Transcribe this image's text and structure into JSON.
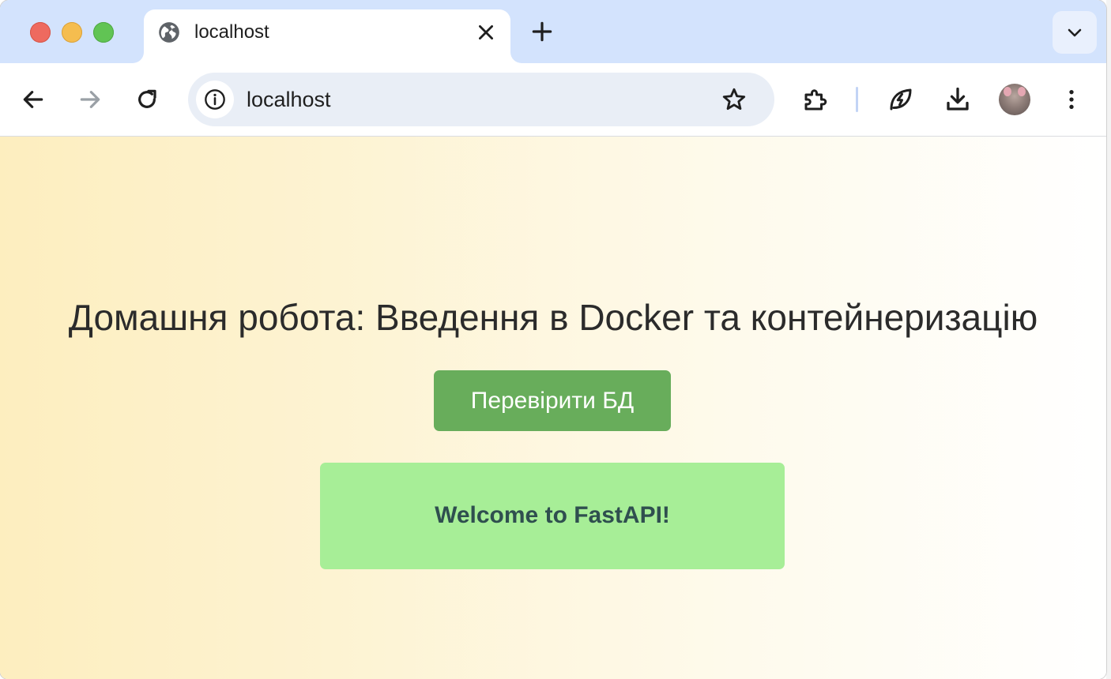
{
  "browser": {
    "tab": {
      "title": "localhost"
    },
    "omnibox": {
      "url": "localhost"
    }
  },
  "page": {
    "heading": "Домашня робота: Введення в Docker та контейнеризацію",
    "check_button_label": "Перевірити БД",
    "result_message": "Welcome to FastAPI!"
  },
  "icons": {
    "favicon": "globe-icon",
    "tab_close": "close-icon",
    "new_tab": "plus-icon",
    "tab_search": "chevron-down-icon",
    "back": "arrow-left-icon",
    "forward": "arrow-right-icon",
    "reload": "reload-icon",
    "site_info": "info-icon",
    "bookmark": "star-icon",
    "extensions": "puzzle-icon",
    "performance": "leaf-bolt-icon",
    "downloads": "download-icon",
    "menu": "kebab-menu-icon"
  },
  "colors": {
    "tabstrip": "#d3e3fd",
    "omnibox": "#e9eef6",
    "button": "#68ad5b",
    "result_box": "#a7ee97",
    "result_text": "#2f4f4f",
    "gradient_start": "#fdeebf"
  }
}
